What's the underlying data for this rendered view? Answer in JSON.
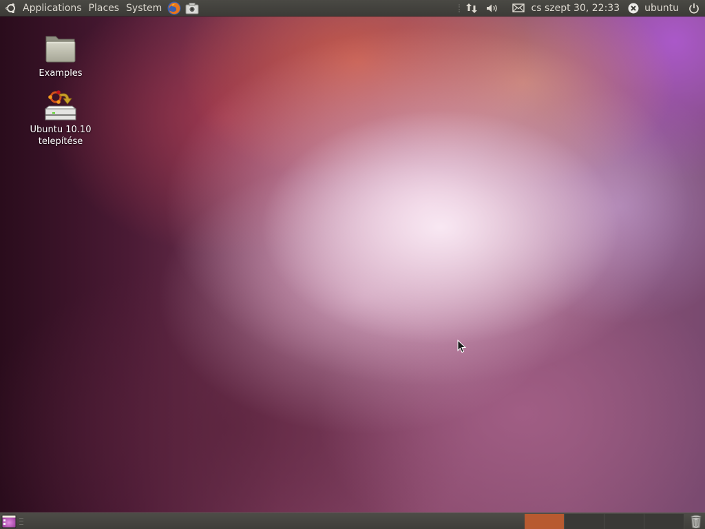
{
  "top_panel": {
    "menus": [
      {
        "label": "Applications"
      },
      {
        "label": "Places"
      },
      {
        "label": "System"
      }
    ],
    "launchers": [
      {
        "name": "firefox",
        "icon": "firefox-icon"
      },
      {
        "name": "screenshot",
        "icon": "camera-icon"
      }
    ],
    "tray": {
      "network_icon": "network-updown-icon",
      "volume_icon": "volume-icon",
      "mail_icon": "envelope-icon",
      "clock": "cs szept 30, 22:33",
      "status_icon": "user-status-icon",
      "username": "ubuntu",
      "power_icon": "power-icon"
    }
  },
  "desktop": {
    "icons": [
      {
        "label": "Examples",
        "icon": "folder-icon"
      },
      {
        "label": "Ubuntu 10.10\ntelepítése",
        "label_line1": "Ubuntu 10.10",
        "label_line2": "telepítése",
        "icon": "installer-icon"
      }
    ]
  },
  "bottom_panel": {
    "show_desktop_icon": "show-desktop-icon",
    "workspaces": [
      {
        "index": 1,
        "active": true
      },
      {
        "index": 2,
        "active": false
      },
      {
        "index": 3,
        "active": false
      },
      {
        "index": 4,
        "active": false
      }
    ],
    "trash_icon": "trash-icon"
  },
  "colors": {
    "panel_bg": "#3c3b37",
    "panel_text": "#dfdbd2",
    "active_workspace": "#b85a30",
    "inactive_workspace": "#3a3936"
  }
}
